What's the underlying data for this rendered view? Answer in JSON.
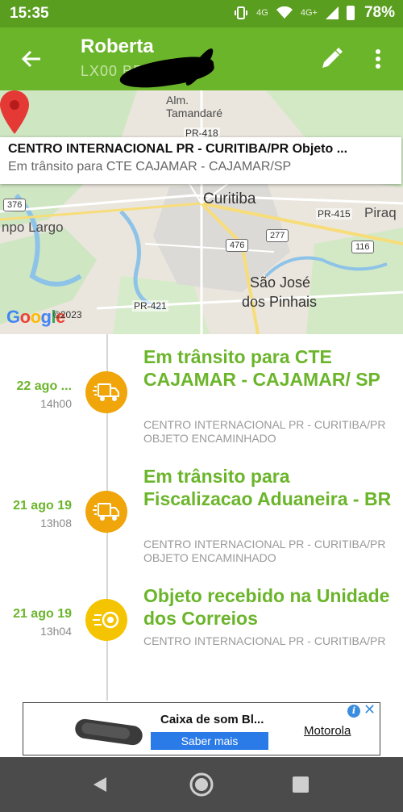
{
  "status_bar": {
    "time": "15:35",
    "network": "4G",
    "network2": "4G+",
    "battery": "78%"
  },
  "app_bar": {
    "title": "Roberta",
    "subtitle": "LX00                 BR"
  },
  "map": {
    "labels": {
      "alm": "Alm.",
      "tamandare": "Tamandaré",
      "pr418": "PR-418",
      "curitiba": "Curitiba",
      "campo_largo": "npo Largo",
      "pira": "Piraq",
      "sao_jose": "São José",
      "dos_pinhais": "dos Pinhais",
      "pr421": "PR-421",
      "pr415": "PR-415",
      "r376": "376",
      "r476": "476",
      "r277": "277",
      "r116": "116"
    },
    "google": [
      "G",
      "o",
      "o",
      "g",
      "l",
      "e"
    ],
    "copyright": "©2023"
  },
  "info_window": {
    "title": "CENTRO INTERNACIONAL PR - CURITIBA/PR Objeto ...",
    "subtitle": "Em trânsito para CTE CAJAMAR - CAJAMAR/SP"
  },
  "events": [
    {
      "date": "22 ago ...",
      "time": "14h00",
      "title": "Em trânsito para CTE CAJAMAR - CAJAMAR/ SP",
      "description": "CENTRO INTERNACIONAL PR - CURITIBA/PR OBJETO ENCAMINHADO",
      "icon": "truck-icon",
      "color": "#f0a50a"
    },
    {
      "date": "21 ago 19",
      "time": "13h08",
      "title": "Em trânsito para Fiscalizacao Aduaneira - BR",
      "description": "CENTRO INTERNACIONAL PR - CURITIBA/PR OBJETO ENCAMINHADO",
      "icon": "truck-icon",
      "color": "#f0a50a"
    },
    {
      "date": "21 ago 19",
      "time": "13h04",
      "title": "Objeto recebido na Unidade dos Correios",
      "description": "CENTRO INTERNACIONAL PR - CURITIBA/PR",
      "icon": "received-icon",
      "color": "#f5c400"
    }
  ],
  "ad": {
    "title": "Caixa de som Bl...",
    "cta": "Saber mais",
    "brand": "Motorola",
    "info_icon": "i",
    "close_icon": "✕"
  },
  "colors": {
    "app_bar": "#6bb52b",
    "status_bar": "#5a9e1f",
    "accent_green": "#6bb52b",
    "pin": "#e53935"
  }
}
